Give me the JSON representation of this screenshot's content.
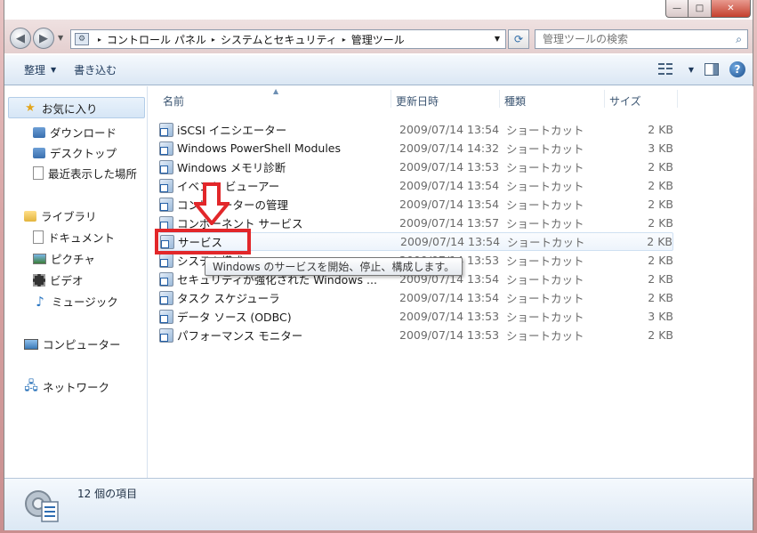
{
  "window": {
    "minimize_glyph": "—",
    "maximize_glyph": "□",
    "close_glyph": "✕"
  },
  "address_bar": {
    "back_glyph": "◀",
    "forward_glyph": "▶",
    "breadcrumbs": [
      "コントロール パネル",
      "システムとセキュリティ",
      "管理ツール"
    ],
    "separator": "▸",
    "dropdown_glyph": "▼",
    "refresh_glyph": "⟳"
  },
  "search": {
    "placeholder": "管理ツールの検索",
    "icon": "search-icon"
  },
  "toolbar": {
    "organize_label": "整理",
    "burn_label": "書き込む",
    "dropdown_glyph": "▼",
    "help_glyph": "?"
  },
  "nav": {
    "favorites_label": "お気に入り",
    "favorites": [
      {
        "label": "ダウンロード",
        "icon": "download-folder-icon"
      },
      {
        "label": "デスクトップ",
        "icon": "desktop-icon"
      },
      {
        "label": "最近表示した場所",
        "icon": "recent-places-icon"
      }
    ],
    "libraries_label": "ライブラリ",
    "libraries": [
      {
        "label": "ドキュメント",
        "icon": "documents-icon"
      },
      {
        "label": "ピクチャ",
        "icon": "pictures-icon"
      },
      {
        "label": "ビデオ",
        "icon": "videos-icon"
      },
      {
        "label": "ミュージック",
        "icon": "music-icon"
      }
    ],
    "computer_label": "コンピューター",
    "network_label": "ネットワーク"
  },
  "columns": {
    "name": "名前",
    "date": "更新日時",
    "type": "種類",
    "size": "サイズ"
  },
  "files": [
    {
      "name": "iSCSI イニシエーター",
      "date": "2009/07/14 13:54",
      "type": "ショートカット",
      "size": "2 KB"
    },
    {
      "name": "Windows PowerShell Modules",
      "date": "2009/07/14 14:32",
      "type": "ショートカット",
      "size": "3 KB"
    },
    {
      "name": "Windows メモリ診断",
      "date": "2009/07/14 13:53",
      "type": "ショートカット",
      "size": "2 KB"
    },
    {
      "name": "イベント ビューアー",
      "date": "2009/07/14 13:54",
      "type": "ショートカット",
      "size": "2 KB"
    },
    {
      "name": "コンピューターの管理",
      "date": "2009/07/14 13:54",
      "type": "ショートカット",
      "size": "2 KB"
    },
    {
      "name": "コンポーネント サービス",
      "date": "2009/07/14 13:57",
      "type": "ショートカット",
      "size": "2 KB"
    },
    {
      "name": "サービス",
      "date": "2009/07/14 13:54",
      "type": "ショートカット",
      "size": "2 KB"
    },
    {
      "name": "システム構成",
      "date": "2009/07/14 13:53",
      "type": "ショートカット",
      "size": "2 KB"
    },
    {
      "name": "セキュリティが強化された Windows ...",
      "date": "2009/07/14 13:54",
      "type": "ショートカット",
      "size": "2 KB"
    },
    {
      "name": "タスク スケジューラ",
      "date": "2009/07/14 13:54",
      "type": "ショートカット",
      "size": "2 KB"
    },
    {
      "name": "データ ソース (ODBC)",
      "date": "2009/07/14 13:53",
      "type": "ショートカット",
      "size": "3 KB"
    },
    {
      "name": "パフォーマンス モニター",
      "date": "2009/07/14 13:53",
      "type": "ショートカット",
      "size": "2 KB"
    }
  ],
  "tooltip": {
    "text": "Windows のサービスを開始、停止、構成します。"
  },
  "status": {
    "item_count": "12 個の項目"
  },
  "colors": {
    "annotation_red": "#e2272a"
  }
}
